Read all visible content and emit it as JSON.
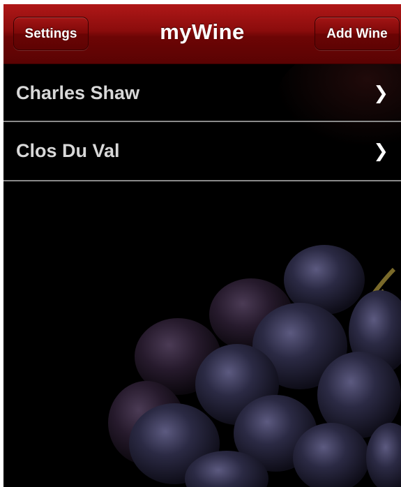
{
  "navbar": {
    "title": "myWine",
    "left_button": "Settings",
    "right_button": "Add Wine",
    "color": "#8a0c0c"
  },
  "wines": [
    {
      "name": "Charles Shaw",
      "icon": "chevron-right-icon"
    },
    {
      "name": "Clos Du Val",
      "icon": "chevron-right-icon"
    }
  ],
  "background": {
    "image": "grapes-photo",
    "color": "#000000"
  }
}
